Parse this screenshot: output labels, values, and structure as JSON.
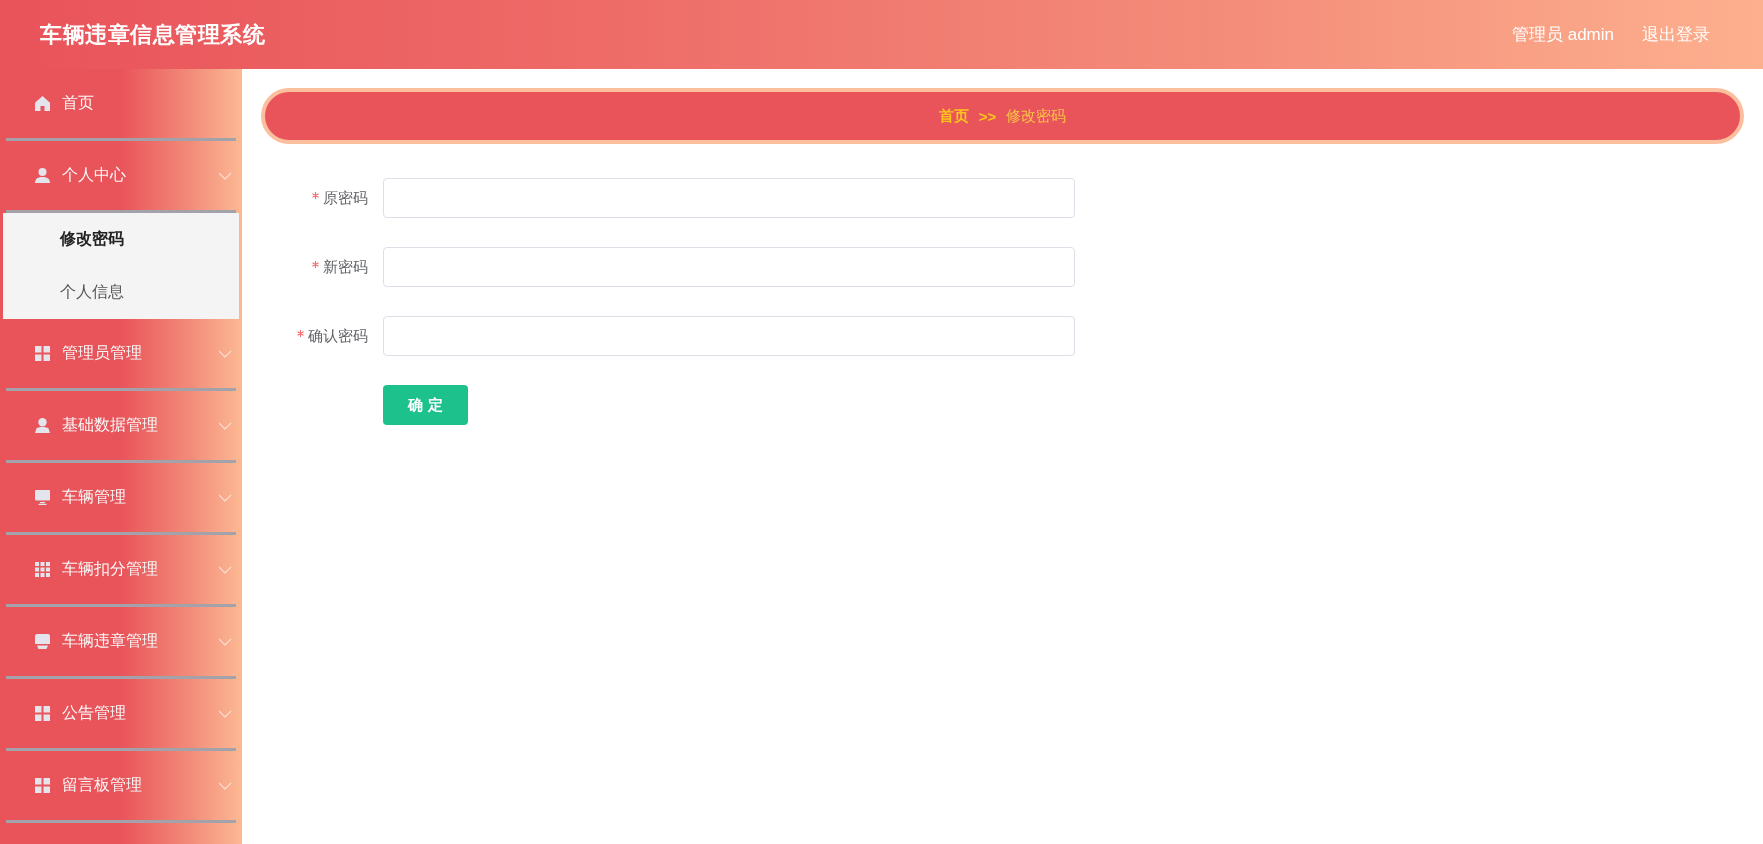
{
  "header": {
    "title": "车辆违章信息管理系统",
    "user": "管理员 admin",
    "logout": "退出登录"
  },
  "sidebar": {
    "items": [
      {
        "label": "首页",
        "kind": "link"
      },
      {
        "label": "个人中心",
        "kind": "submenu",
        "children": [
          {
            "label": "修改密码",
            "selected": true
          },
          {
            "label": "个人信息",
            "selected": false
          }
        ]
      },
      {
        "label": "管理员管理",
        "kind": "submenu"
      },
      {
        "label": "基础数据管理",
        "kind": "submenu"
      },
      {
        "label": "车辆管理",
        "kind": "submenu"
      },
      {
        "label": "车辆扣分管理",
        "kind": "submenu"
      },
      {
        "label": "车辆违章管理",
        "kind": "submenu"
      },
      {
        "label": "公告管理",
        "kind": "submenu"
      },
      {
        "label": "留言板管理",
        "kind": "submenu"
      }
    ]
  },
  "breadcrumb": {
    "items": [
      {
        "label": "首页",
        "kind": "link"
      },
      {
        "label": ">>",
        "kind": "separator"
      },
      {
        "label": "修改密码",
        "kind": "current"
      }
    ]
  },
  "form": {
    "fields": [
      {
        "label": "原密码",
        "required": true
      },
      {
        "label": "新密码",
        "required": true
      },
      {
        "label": "确认密码",
        "required": true
      }
    ],
    "submit": "确 定"
  }
}
